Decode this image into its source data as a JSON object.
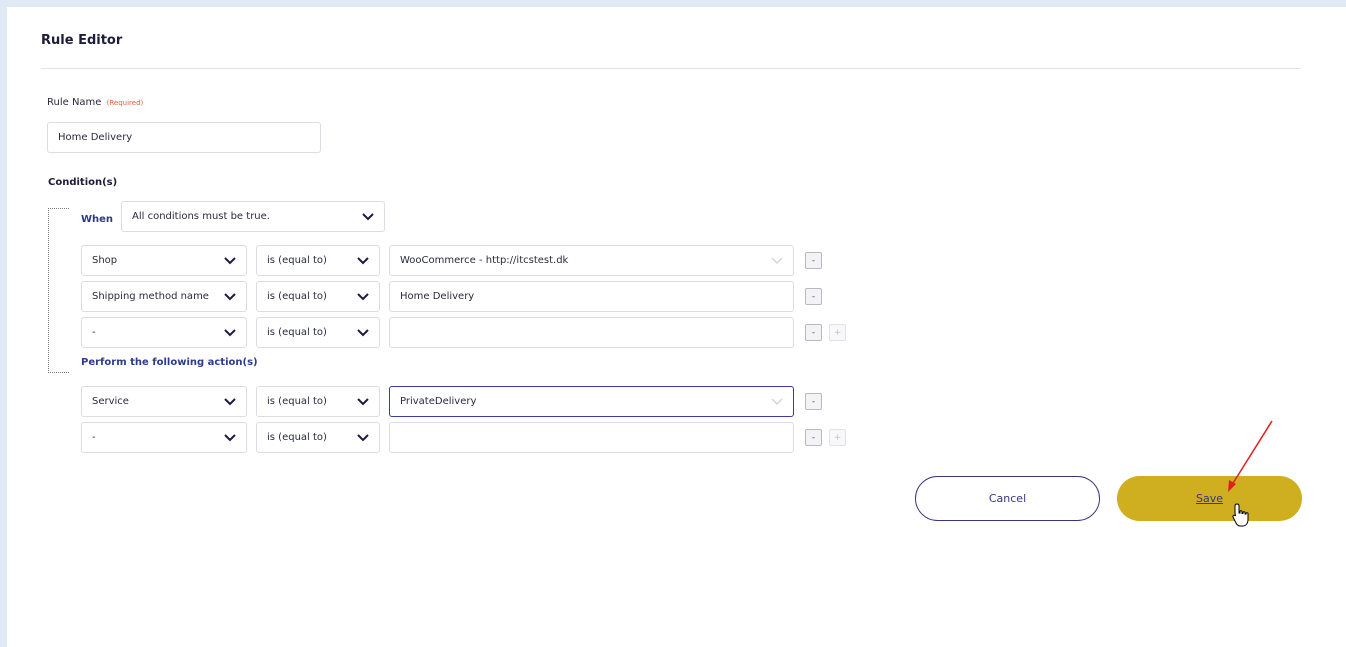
{
  "editor": {
    "title": "Rule Editor",
    "rule_name_label": "Rule Name",
    "rule_name_required": "(Required)",
    "rule_name_value": "Home Delivery",
    "conditions_label": "Condition(s)",
    "when_label": "When",
    "when_value": "All conditions must be true.",
    "actions_label": "Perform the following action(s)"
  },
  "conditions": [
    {
      "field": "Shop",
      "operator": "is (equal to)",
      "value": "WooCommerce - http://itcstest.dk",
      "value_kind": "dropdown"
    },
    {
      "field": "Shipping method name",
      "operator": "is (equal to)",
      "value": "Home Delivery",
      "value_kind": "text"
    },
    {
      "field": "-",
      "operator": "is (equal to)",
      "value": "",
      "value_kind": "text"
    }
  ],
  "actions": [
    {
      "field": "Service",
      "operator": "is (equal to)",
      "value": "PrivateDelivery",
      "value_kind": "dropdown"
    },
    {
      "field": "-",
      "operator": "is (equal to)",
      "value": "",
      "value_kind": "text"
    }
  ],
  "row_buttons": {
    "remove": "-",
    "add": "+"
  },
  "footer": {
    "cancel_label": "Cancel",
    "save_label": "Save"
  },
  "colors": {
    "save_bg": "#cfae1f",
    "accent": "#38357e",
    "annotation_arrow": "#e02020"
  },
  "icons": {
    "dropdown": "chevron-down-icon",
    "cursor": "hand-pointer-icon",
    "annotation": "red-arrow-annotation"
  }
}
